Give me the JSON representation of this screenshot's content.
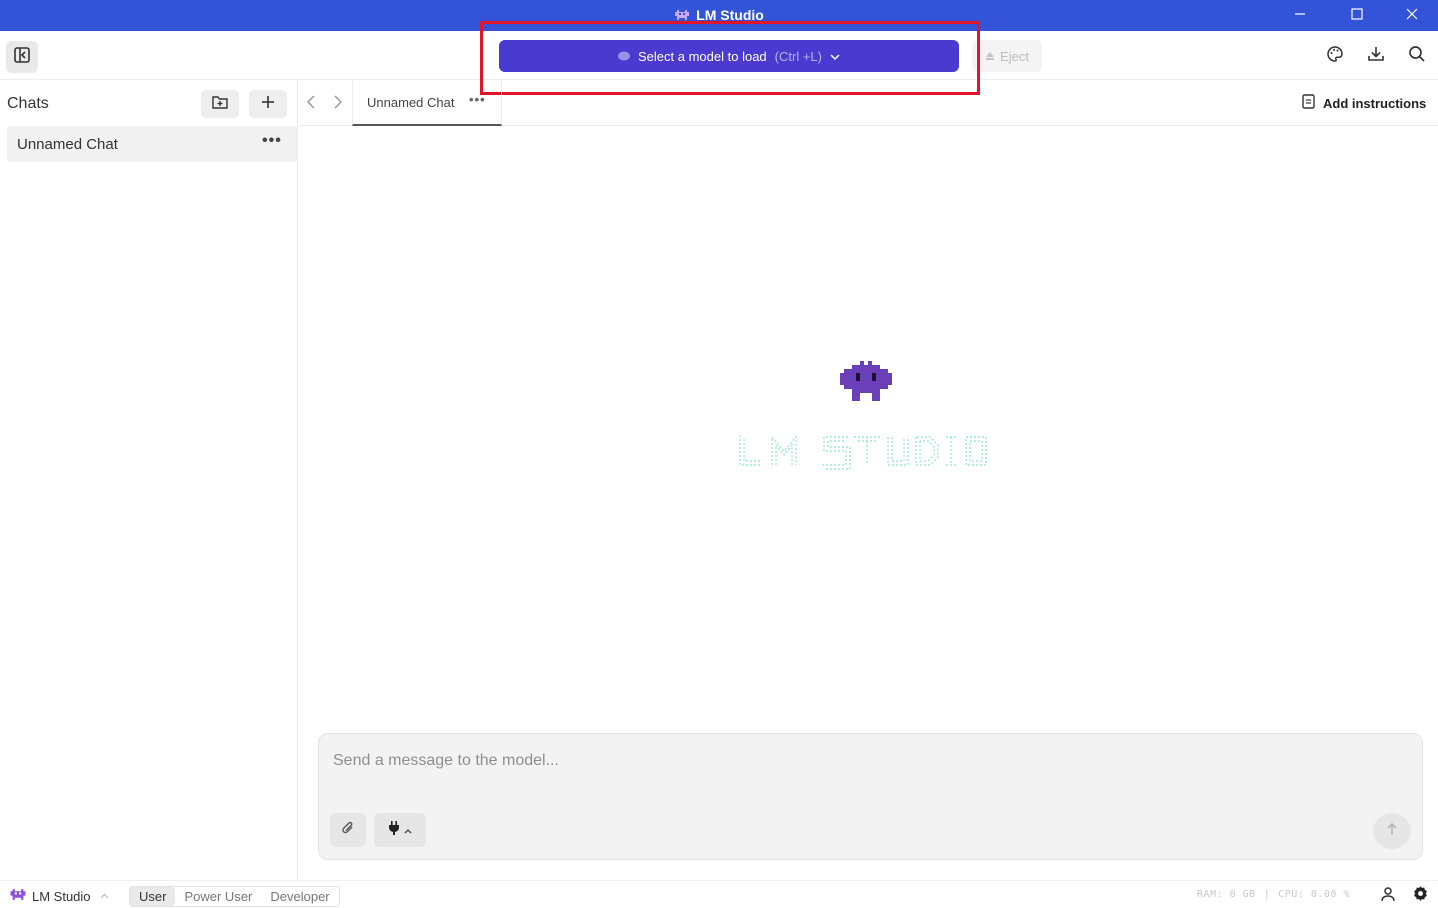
{
  "window": {
    "title": "LM Studio",
    "controls": [
      "minimize-icon",
      "maximize-icon",
      "close-icon"
    ]
  },
  "toolbar": {
    "model_select_label": "Select a model to load",
    "model_select_shortcut": "(Ctrl +L)",
    "eject_label": "Eject",
    "right_icons": [
      "palette-icon",
      "download-icon",
      "search-icon"
    ]
  },
  "sidebar": {
    "title": "Chats",
    "chats": [
      {
        "name": "Unnamed Chat",
        "more": "•••"
      }
    ]
  },
  "tabs": [
    {
      "label": "Unnamed Chat",
      "more": "•••",
      "active": true
    }
  ],
  "instructions": {
    "label": "Add instructions"
  },
  "composer": {
    "placeholder": "Send a message to the model..."
  },
  "statusbar": {
    "brand": "LM Studio",
    "modes": [
      {
        "label": "User",
        "active": true
      },
      {
        "label": "Power User",
        "active": false
      },
      {
        "label": "Developer",
        "active": false
      }
    ],
    "ram": "RAM: 0 GB",
    "cpu": "CPU: 0.00 %"
  },
  "colors": {
    "titlebar": "#3353d9",
    "model_button": "#4a3ad0",
    "highlight_box": "#e0152a",
    "mascot": "#6b3fb8"
  }
}
